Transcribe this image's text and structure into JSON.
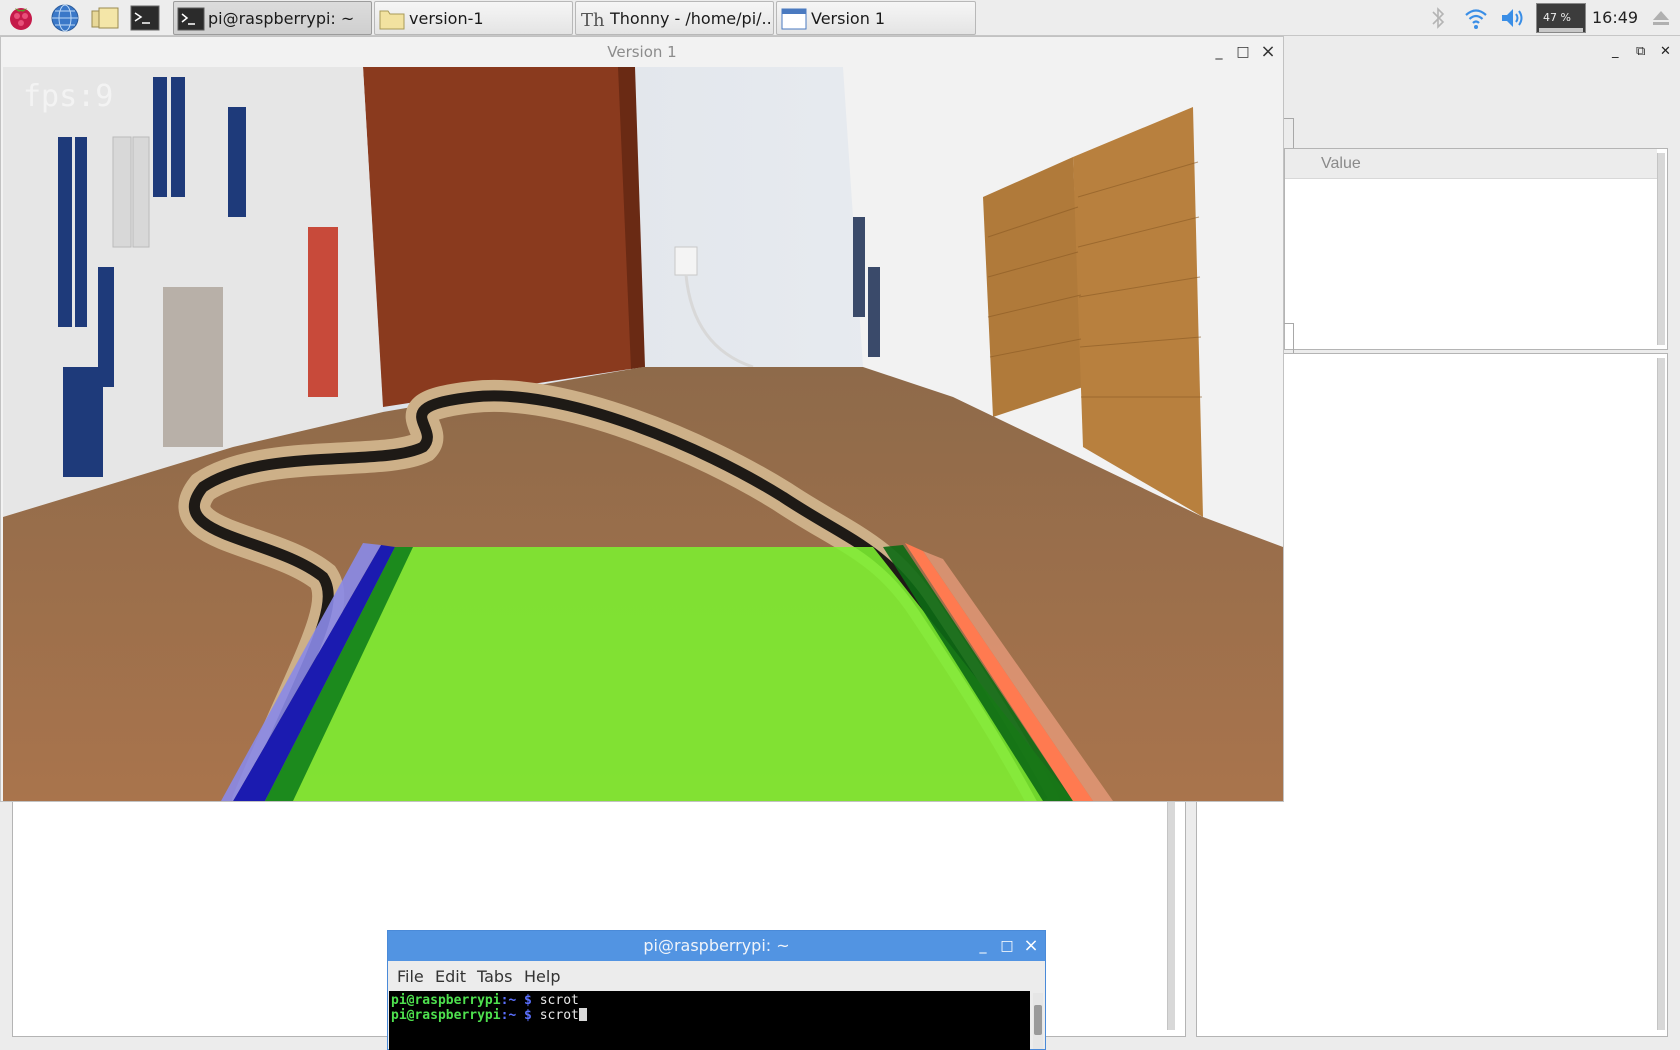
{
  "taskbar": {
    "launchers": [
      {
        "name": "raspberry-menu",
        "icon": "raspberry-icon"
      },
      {
        "name": "web-browser",
        "icon": "globe-icon"
      },
      {
        "name": "file-manager",
        "icon": "folders-icon"
      },
      {
        "name": "terminal",
        "icon": "terminal-icon"
      }
    ],
    "tasks": [
      {
        "label": "pi@raspberrypi: ~",
        "icon": "terminal-icon",
        "active": true
      },
      {
        "label": "version-1",
        "icon": "folder-icon",
        "active": false
      },
      {
        "label": "Thonny  -  /home/pi/...",
        "icon": "thonny-icon",
        "active": false
      },
      {
        "label": "Version 1",
        "icon": "window-icon",
        "active": false
      }
    ],
    "tray": {
      "bluetooth_icon": "bluetooth-icon",
      "wifi_icon": "wifi-icon",
      "volume_icon": "volume-icon",
      "cpu_usage": "47 %",
      "clock": "16:49",
      "eject_icon": "eject-icon"
    }
  },
  "thonny": {
    "variables_header": "Value"
  },
  "camera_window": {
    "title": "Version 1",
    "fps_text": "fps:9",
    "controls": {
      "minimize": "_",
      "maximize": "□",
      "close": "×"
    }
  },
  "terminal": {
    "title": "pi@raspberrypi: ~",
    "menu": [
      "File",
      "Edit",
      "Tabs",
      "Help"
    ],
    "lines": [
      {
        "user": "pi@raspberrypi",
        "path": ":~ $",
        "command": " scrot"
      },
      {
        "user": "pi@raspberrypi",
        "path": ":~ $",
        "command": " scrot"
      }
    ]
  },
  "colors": {
    "lane_fill": "#7cf030",
    "left_lane_line": "#1b1bb0",
    "right_lane_line": "#ff7a50",
    "terminal_title": "#5294e2"
  }
}
